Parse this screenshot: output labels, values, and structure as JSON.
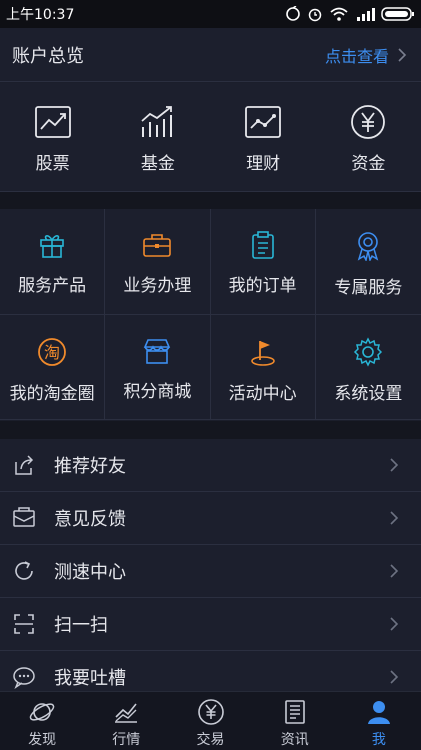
{
  "status_bar": {
    "time": "上午10:37"
  },
  "account_overview": {
    "title": "账户总览",
    "link_label": "点击查看"
  },
  "quick_entries": [
    {
      "label": "股票",
      "icon": "stock-chart-icon"
    },
    {
      "label": "基金",
      "icon": "fund-chart-icon"
    },
    {
      "label": "理财",
      "icon": "finance-chart-icon"
    },
    {
      "label": "资金",
      "icon": "yen-coin-icon"
    }
  ],
  "service_grid": [
    {
      "label": "服务产品",
      "icon": "gift-icon"
    },
    {
      "label": "业务办理",
      "icon": "briefcase-icon"
    },
    {
      "label": "我的订单",
      "icon": "clipboard-icon"
    },
    {
      "label": "专属服务",
      "icon": "ribbon-badge-icon"
    },
    {
      "label": "我的淘金圈",
      "icon": "tao-circle-icon",
      "icon_text": "淘"
    },
    {
      "label": "积分商城",
      "icon": "storefront-icon"
    },
    {
      "label": "活动中心",
      "icon": "flag-icon"
    },
    {
      "label": "系统设置",
      "icon": "gear-icon"
    }
  ],
  "menu_list": [
    {
      "label": "推荐好友",
      "icon": "share-icon"
    },
    {
      "label": "意见反馈",
      "icon": "feedback-mail-icon"
    },
    {
      "label": "测速中心",
      "icon": "refresh-icon"
    },
    {
      "label": "扫一扫",
      "icon": "scan-icon"
    },
    {
      "label": "我要吐槽",
      "icon": "chat-bubble-icon"
    }
  ],
  "tab_bar": {
    "active": "我",
    "tabs": [
      {
        "label": "发现",
        "icon": "planet-icon"
      },
      {
        "label": "行情",
        "icon": "trend-icon"
      },
      {
        "label": "交易",
        "icon": "yen-icon"
      },
      {
        "label": "资讯",
        "icon": "news-icon"
      },
      {
        "label": "我",
        "icon": "profile-icon"
      }
    ]
  },
  "colors": {
    "background": "#1b1e2b",
    "section_gap": "#14161f",
    "accent_blue": "#3d8ef0",
    "accent_orange": "#f08a2c",
    "accent_teal": "#29b6d6"
  }
}
